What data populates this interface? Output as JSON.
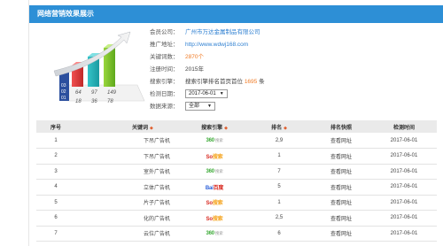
{
  "header": {
    "title": "网络营销效果展示"
  },
  "art": {
    "rows": [
      {
        "row": "03",
        "values": [
          "64",
          "97",
          "149"
        ]
      },
      {
        "row": "01",
        "values": [
          "18",
          "36",
          "78"
        ]
      }
    ],
    "row02": "02"
  },
  "info": {
    "company": {
      "label": "会员公司：",
      "value": "广州市万达金属制品有限公司"
    },
    "url": {
      "label": "推广地址：",
      "value": "http://www.wdwj168.com"
    },
    "keywords": {
      "label": "关键词数：",
      "value": "2870个"
    },
    "regtime": {
      "label": "注册时间：",
      "value": "2015年"
    },
    "engine": {
      "label": "搜索引擎：",
      "prefix": "搜索引擎排名首页首位",
      "count": "1695",
      "suffix": "条"
    },
    "date": {
      "label": "检测日期：",
      "value": "2017-06-01"
    },
    "source": {
      "label": "数据来源：",
      "value": "全部"
    }
  },
  "table": {
    "headers": {
      "no": "序号",
      "keyword": "关键词",
      "engine": "搜索引擎",
      "rank": "排名",
      "snapshot": "排名快照",
      "date": "检测时间"
    },
    "rows": [
      {
        "no": "1",
        "keyword": "下吊广告机",
        "engine": "360",
        "rank": "2,9",
        "snapshot": "查看网址",
        "date": "2017-06-01"
      },
      {
        "no": "2",
        "keyword": "下吊广告机",
        "engine": "so",
        "rank": "1",
        "snapshot": "查看网址",
        "date": "2017-06-01"
      },
      {
        "no": "3",
        "keyword": "室外广告机",
        "engine": "360",
        "rank": "7",
        "snapshot": "查看网址",
        "date": "2017-06-01"
      },
      {
        "no": "4",
        "keyword": "立体广告机",
        "engine": "baidu",
        "rank": "5",
        "snapshot": "查看网址",
        "date": "2017-06-01"
      },
      {
        "no": "5",
        "keyword": "片子广告机",
        "engine": "so",
        "rank": "1",
        "snapshot": "查看网址",
        "date": "2017-06-01"
      },
      {
        "no": "6",
        "keyword": "化的广告机",
        "engine": "so",
        "rank": "2,5",
        "snapshot": "查看网址",
        "date": "2017-06-01"
      },
      {
        "no": "7",
        "keyword": "云位广告机",
        "engine": "360",
        "rank": "6",
        "snapshot": "查看网址",
        "date": "2017-06-01"
      }
    ]
  },
  "engines": {
    "e360": {
      "main": "360",
      "sub": "搜索"
    },
    "so": {
      "main": "So",
      "accent": "S",
      "tail": "搜索"
    },
    "baidu": {
      "main": "Bai",
      "accent": "百度"
    }
  },
  "colors": {
    "header": "#2d8fd6",
    "link": "#2d7fd1",
    "highlight": "#f07a24"
  }
}
